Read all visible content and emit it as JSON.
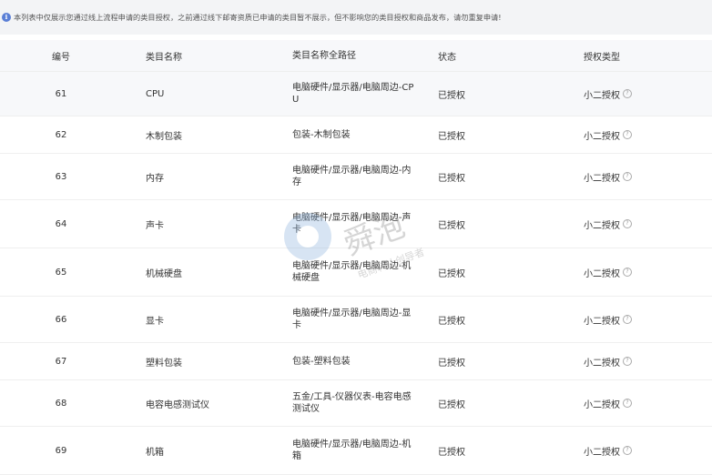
{
  "notice": {
    "text": "本列表中仅展示您通过线上流程申请的类目授权，之前通过线下邮寄资质已申请的类目暂不展示，但不影响您的类目授权和商品发布，请勿重复申请!"
  },
  "table": {
    "headers": [
      "编号",
      "类目名称",
      "类目名称全路径",
      "状态",
      "授权类型"
    ],
    "rows": [
      {
        "id": "61",
        "name": "CPU",
        "path": "电脑硬件/显示器/电脑周边-CPU",
        "status": "已授权",
        "type": "小二授权"
      },
      {
        "id": "62",
        "name": "木制包装",
        "path": "包装-木制包装",
        "status": "已授权",
        "type": "小二授权"
      },
      {
        "id": "63",
        "name": "内存",
        "path": "电脑硬件/显示器/电脑周边-内存",
        "status": "已授权",
        "type": "小二授权"
      },
      {
        "id": "64",
        "name": "声卡",
        "path": "电脑硬件/显示器/电脑周边-声卡",
        "status": "已授权",
        "type": "小二授权"
      },
      {
        "id": "65",
        "name": "机械硬盘",
        "path": "电脑硬件/显示器/电脑周边-机械硬盘",
        "status": "已授权",
        "type": "小二授权"
      },
      {
        "id": "66",
        "name": "显卡",
        "path": "电脑硬件/显示器/电脑周边-显卡",
        "status": "已授权",
        "type": "小二授权"
      },
      {
        "id": "67",
        "name": "塑料包装",
        "path": "包装-塑料包装",
        "status": "已授权",
        "type": "小二授权"
      },
      {
        "id": "68",
        "name": "电容电感测试仪",
        "path": "五金/工具-仪器仪表-电容电感测试仪",
        "status": "已授权",
        "type": "小二授权"
      },
      {
        "id": "69",
        "name": "机箱",
        "path": "电脑硬件/显示器/电脑周边-机箱",
        "status": "已授权",
        "type": "小二授权"
      }
    ]
  },
  "watermark": {
    "brand": "舜泡",
    "sub": "电商转让创导者"
  },
  "colors": {
    "info_icon": "#5a7fd6",
    "header_bg": "#f7f8fa",
    "notice_bg": "#f3f4f6"
  },
  "icons": {
    "info": "info-icon",
    "help": "question-circle-icon"
  }
}
